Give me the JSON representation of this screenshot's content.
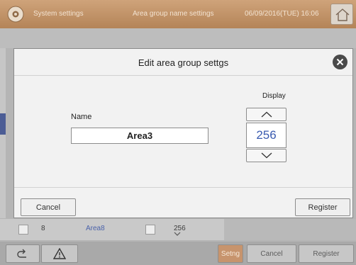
{
  "topbar": {
    "title": "System settings",
    "screen": "Area group name settings",
    "datetime": "06/09/2016(TUE) 16:06",
    "home_icon": "home-icon",
    "gear_icon": "gear-icon"
  },
  "modal": {
    "title": "Edit area group settgs",
    "name_label": "Name",
    "name_value": "Area3",
    "display_label": "Display",
    "display_value": "256",
    "cancel_label": "Cancel",
    "register_label": "Register"
  },
  "background_row": {
    "index": "8",
    "area_name": "Area8",
    "display": "256"
  },
  "bottombar": {
    "setng_label": "Setng",
    "cancel_label": "Cancel",
    "register_label": "Register",
    "back_icon": "back-arrow-icon",
    "warning_icon": "warning-icon"
  },
  "colors": {
    "topbar": "#c49a70",
    "accent_blue": "#3a5bb0",
    "close_button": "#4a4a4a"
  }
}
